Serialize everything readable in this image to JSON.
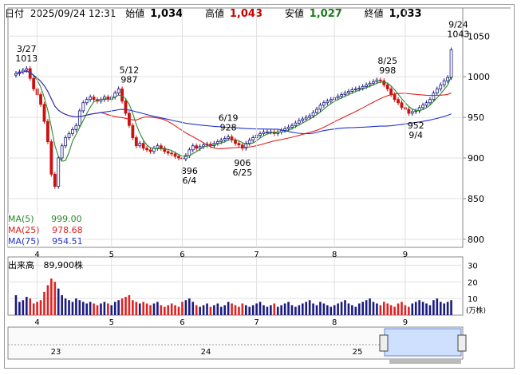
{
  "header": {
    "date_label": "日付",
    "date_value": "2025/09/24 12:31",
    "open_label": "始値",
    "open_value": "1,034",
    "high_label": "高値",
    "high_value": "1,043",
    "low_label": "安値",
    "low_value": "1,027",
    "close_label": "終値",
    "close_value": "1,033"
  },
  "colors": {
    "up": "#1a1a80",
    "down": "#cc1111",
    "ma5": "#2a8a2a",
    "ma25": "#e02020",
    "ma75": "#2233cc",
    "high": "#cc0000",
    "low": "#1a7a1a",
    "volume_up": "#1a1a80",
    "volume_down": "#dd2222",
    "grid": "#e0e0e0"
  },
  "moving_averages": [
    {
      "label": "MA(5)",
      "value": "999.00"
    },
    {
      "label": "MA(25)",
      "value": "978.68"
    },
    {
      "label": "MA(75)",
      "value": "954.51"
    }
  ],
  "volume": {
    "label": "出来高",
    "value": "89,900株",
    "unit": "(万株)",
    "ticks": [
      "30",
      "20",
      "10"
    ]
  },
  "price_axis": [
    "1050",
    "1000",
    "950",
    "900",
    "850",
    "800"
  ],
  "month_labels": [
    "4",
    "5",
    "6",
    "7",
    "8",
    "9"
  ],
  "navigator": {
    "labels": [
      "23",
      "24",
      "25"
    ]
  },
  "annotations": [
    {
      "date": "3/27",
      "price": "1013"
    },
    {
      "date": "5/12",
      "price": "987"
    },
    {
      "date": "6/19",
      "price": "928"
    },
    {
      "date": "8/25",
      "price": "998"
    },
    {
      "date": "9/24",
      "price": "1043"
    },
    {
      "date": "6/4",
      "price": "896"
    },
    {
      "date": "6/25",
      "price": "906"
    },
    {
      "date": "9/4",
      "price": "952"
    }
  ],
  "chart_data": {
    "type": "candlestick",
    "y_range": [
      790,
      1065
    ],
    "dates": [
      "3/24",
      "3/25",
      "3/26",
      "3/27",
      "3/28",
      "3/31",
      "4/1",
      "4/2",
      "4/3",
      "4/4",
      "4/7",
      "4/8",
      "4/9",
      "4/10",
      "4/11",
      "4/14",
      "4/15",
      "4/16",
      "4/17",
      "4/18",
      "4/21",
      "4/22",
      "4/23",
      "4/24",
      "4/25",
      "4/28",
      "4/30",
      "5/1",
      "5/2",
      "5/7",
      "5/8",
      "5/9",
      "5/12",
      "5/13",
      "5/14",
      "5/15",
      "5/16",
      "5/19",
      "5/20",
      "5/21",
      "5/22",
      "5/23",
      "5/26",
      "5/27",
      "5/28",
      "5/29",
      "5/30",
      "6/2",
      "6/3",
      "6/4",
      "6/5",
      "6/6",
      "6/9",
      "6/10",
      "6/11",
      "6/12",
      "6/13",
      "6/16",
      "6/17",
      "6/18",
      "6/19",
      "6/20",
      "6/23",
      "6/24",
      "6/25",
      "6/26",
      "6/27",
      "6/30",
      "7/1",
      "7/2",
      "7/3",
      "7/4",
      "7/7",
      "7/8",
      "7/9",
      "7/10",
      "7/11",
      "7/14",
      "7/15",
      "7/16",
      "7/17",
      "7/18",
      "7/22",
      "7/23",
      "7/24",
      "7/25",
      "7/28",
      "7/29",
      "7/30",
      "7/31",
      "8/1",
      "8/4",
      "8/5",
      "8/6",
      "8/7",
      "8/8",
      "8/12",
      "8/13",
      "8/14",
      "8/15",
      "8/18",
      "8/19",
      "8/20",
      "8/21",
      "8/22",
      "8/25",
      "8/26",
      "8/27",
      "8/28",
      "8/29",
      "9/1",
      "9/2",
      "9/3",
      "9/4",
      "9/5",
      "9/8",
      "9/9",
      "9/10",
      "9/11",
      "9/12",
      "9/16",
      "9/17",
      "9/18",
      "9/19",
      "9/22",
      "9/24"
    ],
    "close": [
      1004,
      1006,
      1008,
      1010,
      998,
      985,
      978,
      966,
      945,
      920,
      880,
      865,
      900,
      915,
      925,
      930,
      935,
      940,
      958,
      968,
      972,
      975,
      972,
      970,
      972,
      975,
      972,
      975,
      980,
      985,
      970,
      955,
      940,
      925,
      915,
      918,
      912,
      910,
      908,
      912,
      915,
      912,
      908,
      906,
      905,
      902,
      900,
      899,
      903,
      910,
      915,
      912,
      914,
      916,
      917,
      915,
      918,
      920,
      922,
      924,
      926,
      922,
      918,
      916,
      912,
      918,
      922,
      925,
      928,
      930,
      932,
      932,
      932,
      930,
      932,
      934,
      936,
      938,
      940,
      943,
      946,
      948,
      950,
      952,
      956,
      960,
      965,
      968,
      970,
      972,
      974,
      976,
      978,
      980,
      982,
      984,
      985,
      986,
      988,
      990,
      992,
      994,
      996,
      995,
      990,
      985,
      978,
      972,
      968,
      962,
      960,
      955,
      957,
      958,
      962,
      965,
      968,
      972,
      980,
      985,
      990,
      995,
      999,
      1033
    ],
    "volume": [
      12,
      8,
      9,
      11,
      10,
      7,
      8,
      9,
      14,
      18,
      22,
      20,
      16,
      12,
      10,
      9,
      8,
      10,
      9,
      8,
      7,
      8,
      7,
      6,
      7,
      8,
      7,
      6,
      8,
      9,
      10,
      11,
      12,
      9,
      8,
      7,
      8,
      7,
      6,
      7,
      8,
      6,
      5,
      6,
      7,
      6,
      5,
      8,
      9,
      10,
      8,
      6,
      5,
      6,
      7,
      5,
      6,
      7,
      5,
      6,
      8,
      7,
      6,
      5,
      7,
      6,
      5,
      6,
      7,
      8,
      6,
      5,
      6,
      7,
      5,
      6,
      7,
      8,
      6,
      5,
      6,
      7,
      8,
      9,
      7,
      6,
      8,
      7,
      6,
      5,
      6,
      7,
      8,
      9,
      7,
      6,
      5,
      7,
      8,
      9,
      10,
      8,
      7,
      6,
      8,
      7,
      6,
      5,
      7,
      8,
      6,
      5,
      7,
      8,
      9,
      8,
      7,
      6,
      9,
      10,
      8,
      7,
      8,
      9
    ]
  }
}
